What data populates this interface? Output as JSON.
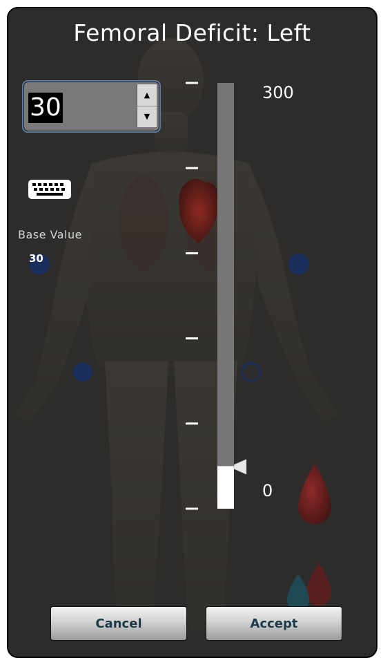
{
  "dialog": {
    "title": "Femoral Deficit: Left"
  },
  "spinbox": {
    "value": "30",
    "up_icon": "arrow-up-icon",
    "down_icon": "arrow-down-icon"
  },
  "keyboard": {
    "icon": "keyboard-icon"
  },
  "base": {
    "label": "Base Value",
    "value": "30"
  },
  "slider": {
    "max_label": "300",
    "min_label": "0",
    "min": 0,
    "max": 300,
    "value": 30,
    "tick_count": 6
  },
  "buttons": {
    "cancel": "Cancel",
    "accept": "Accept"
  },
  "colors": {
    "panel": "#2d2c2b",
    "track": "#777777",
    "fill": "#ffffff",
    "spin_border": "#5a7da8",
    "button_text": "#1c3a4a",
    "pulse_dot": "#1a2f5e"
  }
}
